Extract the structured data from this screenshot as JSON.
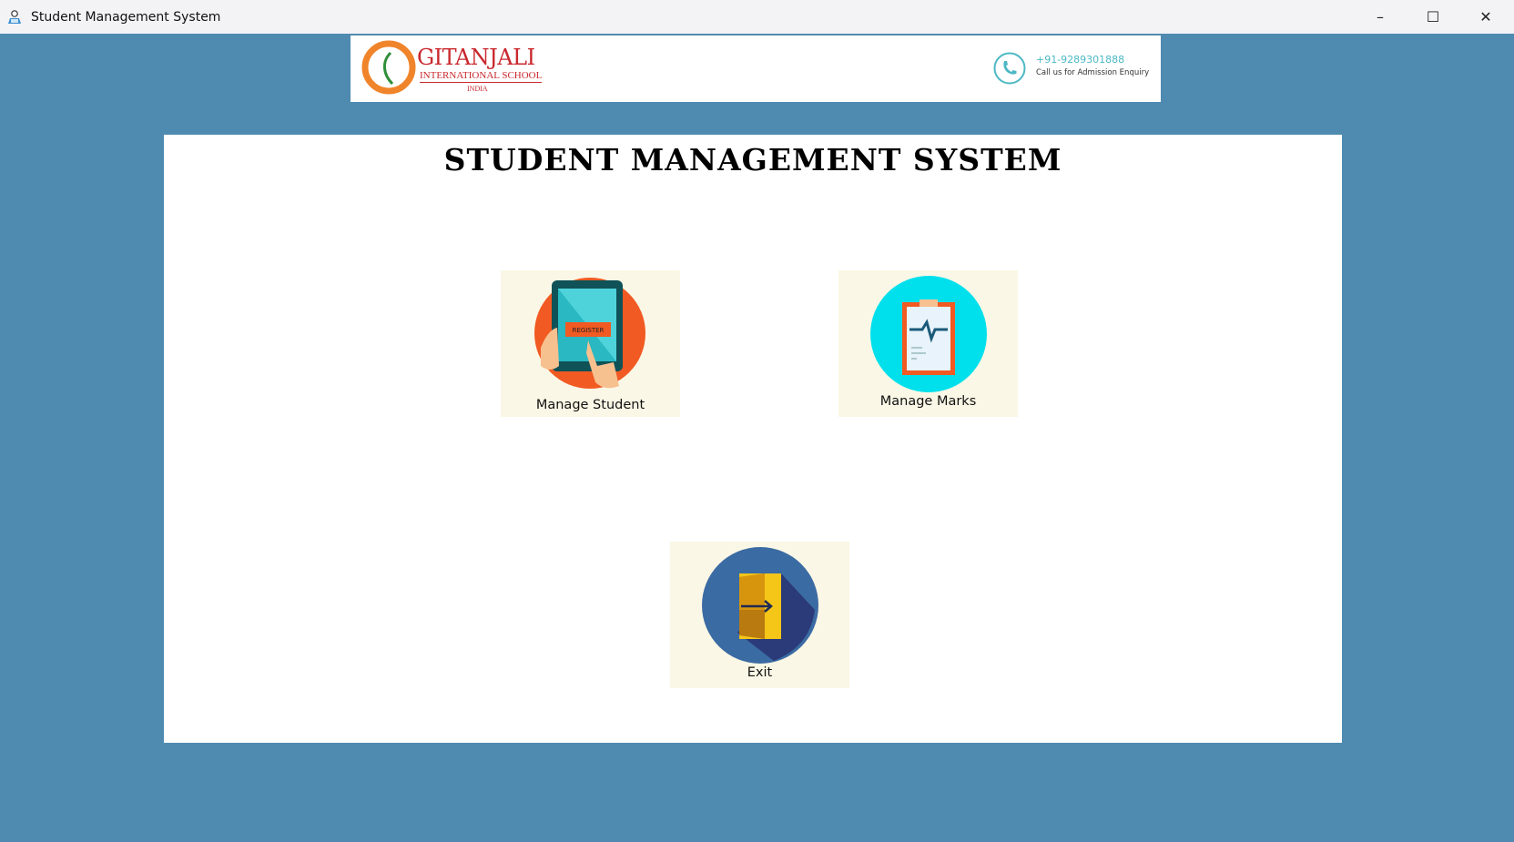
{
  "window": {
    "title": "Student Management System",
    "controls": {
      "minimize": "–",
      "maximize": "☐",
      "close": "✕"
    }
  },
  "header": {
    "school_name": "GITANJALI",
    "school_subtitle": "INTERNATIONAL SCHOOL",
    "school_country": "INDIA",
    "phone": "+91-9289301888",
    "phone_caption": "Call us for Admission Enquiry"
  },
  "main": {
    "title": "STUDENT MANAGEMENT SYSTEM",
    "tiles": [
      {
        "label": "Manage Student",
        "icon": "tablet-register-icon",
        "badge": "REGISTER"
      },
      {
        "label": "Manage Marks",
        "icon": "clipboard-chart-icon"
      },
      {
        "label": "Exit",
        "icon": "exit-door-icon"
      }
    ]
  },
  "colors": {
    "background": "#4f8bb0",
    "tile": "#fbf7e6",
    "brand_red": "#c9282d",
    "accent_teal": "#4cb8c4"
  }
}
